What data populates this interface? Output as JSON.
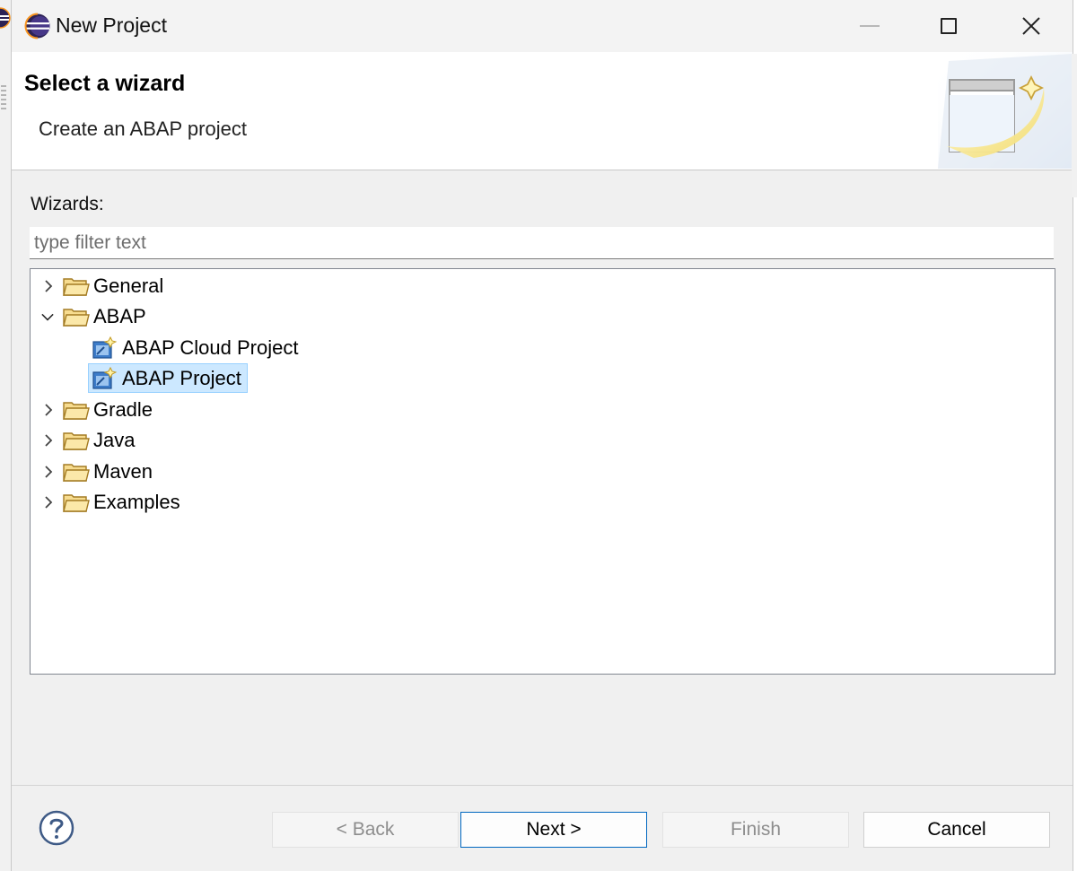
{
  "window": {
    "title": "New Project",
    "app_icon": "eclipse-icon",
    "controls": [
      "minimize-icon",
      "maximize-icon",
      "close-icon"
    ]
  },
  "header": {
    "title": "Select a wizard",
    "description": "Create an ABAP project",
    "graphic": "new-wizard-icon"
  },
  "wizards": {
    "label": "Wizards:",
    "filter_placeholder": "type filter text",
    "filter_value": "",
    "tree": [
      {
        "label": "General",
        "expanded": false,
        "icon": "folder-icon"
      },
      {
        "label": "ABAP",
        "expanded": true,
        "icon": "folder-icon",
        "children": [
          {
            "label": "ABAP Cloud Project",
            "icon": "abap-project-wizard-icon",
            "selected": false
          },
          {
            "label": "ABAP Project",
            "icon": "abap-project-wizard-icon",
            "selected": true
          }
        ]
      },
      {
        "label": "Gradle",
        "expanded": false,
        "icon": "folder-icon"
      },
      {
        "label": "Java",
        "expanded": false,
        "icon": "folder-icon"
      },
      {
        "label": "Maven",
        "expanded": false,
        "icon": "folder-icon"
      },
      {
        "label": "Examples",
        "expanded": false,
        "icon": "folder-icon"
      }
    ]
  },
  "footer": {
    "help_icon": "help-icon",
    "back_label": "< Back",
    "next_label": "Next >",
    "finish_label": "Finish",
    "cancel_label": "Cancel"
  },
  "colors": {
    "selection_bg": "#cce8ff",
    "selection_border": "#99d1ff",
    "default_button_border": "#0067c0",
    "folder_yellow": "#f0c65a"
  }
}
